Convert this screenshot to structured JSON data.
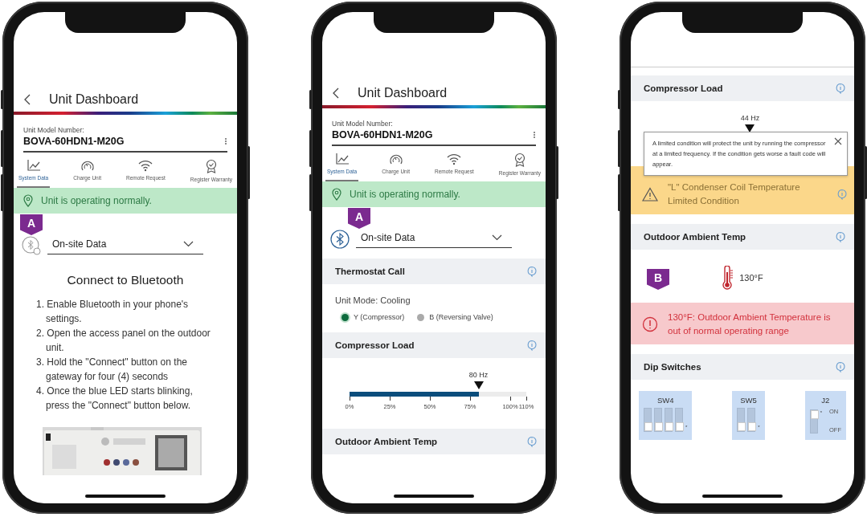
{
  "phones": [
    {
      "blocks": [
        {
          "kind": "header",
          "title": "Unit Dashboard"
        },
        {
          "kind": "model",
          "label": "Unit Model Number:",
          "value": "BOVA-60HDN1-M20G"
        },
        {
          "kind": "tabs",
          "items": [
            {
              "label": "System Data",
              "selected": true
            },
            {
              "label": "Charge Unit",
              "selected": false
            },
            {
              "label": "Remote Request",
              "selected": false
            },
            {
              "label": "Register Warranty",
              "selected": false
            }
          ]
        },
        {
          "kind": "status",
          "text": "Unit is operating normally."
        },
        {
          "kind": "source",
          "value": "On-site Data",
          "connected": false,
          "badge": "A"
        },
        {
          "kind": "title",
          "text": "Connect to Bluetooth"
        },
        {
          "kind": "steps",
          "items": [
            "1. Enable Bluetooth in your phone's settings.",
            "2. Open the access panel on the outdoor unit.",
            "3. Hold the \"Connect\" button on the gateway for four (4) seconds",
            "4. Once the blue LED starts blinking, press the \"Connect\" button below."
          ]
        },
        {
          "kind": "picture"
        }
      ]
    },
    {
      "blocks": [
        {
          "kind": "header",
          "title": "Unit Dashboard"
        },
        {
          "kind": "model",
          "label": "Unit Model Number:",
          "value": "BOVA-60HDN1-M20G"
        },
        {
          "kind": "tabs",
          "items": [
            {
              "label": "System Data",
              "selected": true
            },
            {
              "label": "Charge Unit",
              "selected": false
            },
            {
              "label": "Remote Request",
              "selected": false
            },
            {
              "label": "Register Warranty",
              "selected": false
            }
          ]
        },
        {
          "kind": "status",
          "text": "Unit is operating normally."
        },
        {
          "kind": "source",
          "value": "On-site Data",
          "connected": true,
          "badge": "A"
        },
        {
          "kind": "section",
          "title": "Thermostat Call"
        },
        {
          "kind": "mode",
          "text": "Unit Mode: Cooling",
          "indicators": [
            {
              "label": "Y (Compressor)",
              "on": true
            },
            {
              "label": "B (Reversing Valve)",
              "on": false
            }
          ]
        },
        {
          "kind": "section",
          "title": "Compressor Load"
        },
        {
          "kind": "gauge",
          "reading": "80 Hz",
          "level": 0.73,
          "ticks": [
            "0%",
            "25%",
            "50%",
            "75%",
            "100%",
            "110%"
          ]
        },
        {
          "kind": "section",
          "title": "Outdoor Ambient Temp"
        }
      ]
    },
    {
      "blocks": [
        {
          "kind": "section",
          "title": "Compressor Load"
        },
        {
          "kind": "gauge",
          "reading": "44 Hz",
          "level": 0.52
        },
        {
          "kind": "tooltip",
          "text": "A limited condition will protect the unit by running the compressor at a limited frequency. If the condition gets worse a fault code will appear."
        },
        {
          "kind": "warning",
          "text": "\"L\" Condenser Coil Temperature Limited Condition"
        },
        {
          "kind": "section",
          "title": "Outdoor Ambient Temp"
        },
        {
          "kind": "temp",
          "reading": "130°F",
          "badge": "B"
        },
        {
          "kind": "error",
          "text": "130°F: Outdoor Ambient Temperature is out of normal operating range"
        },
        {
          "kind": "section",
          "title": "Dip Switches"
        },
        {
          "kind": "switches",
          "groups": [
            {
              "label": "SW4",
              "mark": "*",
              "switches": [
                {
                  "on": false
                },
                {
                  "on": false
                },
                {
                  "on": false
                },
                {
                  "on": false
                }
              ]
            },
            {
              "label": "SW5",
              "mark": "*",
              "switches": [
                {
                  "on": false
                },
                {
                  "on": false
                }
              ]
            },
            {
              "label": "J2",
              "mark": "*",
              "on_label": "ON",
              "off_label": "OFF",
              "switches": [
                {
                  "on": true
                }
              ]
            }
          ]
        }
      ]
    }
  ]
}
